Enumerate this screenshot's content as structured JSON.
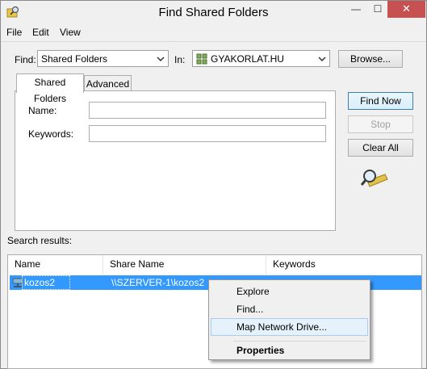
{
  "window": {
    "title": "Find Shared Folders",
    "close_glyph": "✕",
    "minimize_glyph": "—",
    "maximize_glyph": "☐"
  },
  "menu": {
    "items": [
      {
        "label": "File"
      },
      {
        "label": "Edit"
      },
      {
        "label": "View"
      }
    ]
  },
  "find": {
    "find_label": "Find:",
    "find_value": "Shared Folders",
    "in_label": "In:",
    "in_value": "GYAKORLAT.HU",
    "browse_label": "Browse..."
  },
  "tabs": [
    {
      "label": "Shared Folders",
      "active": true
    },
    {
      "label": "Advanced",
      "active": false
    }
  ],
  "fields": {
    "name_label": "Name:",
    "name_value": "",
    "keywords_label": "Keywords:",
    "keywords_value": ""
  },
  "buttons": {
    "find_now": "Find Now",
    "stop": "Stop",
    "clear_all": "Clear All"
  },
  "results": {
    "label": "Search results:",
    "columns": [
      "Name",
      "Share Name",
      "Keywords"
    ],
    "rows": [
      {
        "name": "kozos2",
        "share_name": "\\\\SZERVER-1\\kozos2",
        "keywords": ""
      }
    ]
  },
  "context_menu": {
    "items": [
      {
        "label": "Explore"
      },
      {
        "label": "Find..."
      },
      {
        "label": "Map Network Drive..."
      },
      {
        "label": "Properties"
      }
    ]
  },
  "colors": {
    "selection": "#3399ff",
    "close_button": "#c75050",
    "menu_highlight": "#e5f1fb"
  },
  "icons": [
    "app-search-icon",
    "share-folder-icon",
    "domain-icon",
    "search-magnifier-icon",
    "chevron-down-icon"
  ]
}
